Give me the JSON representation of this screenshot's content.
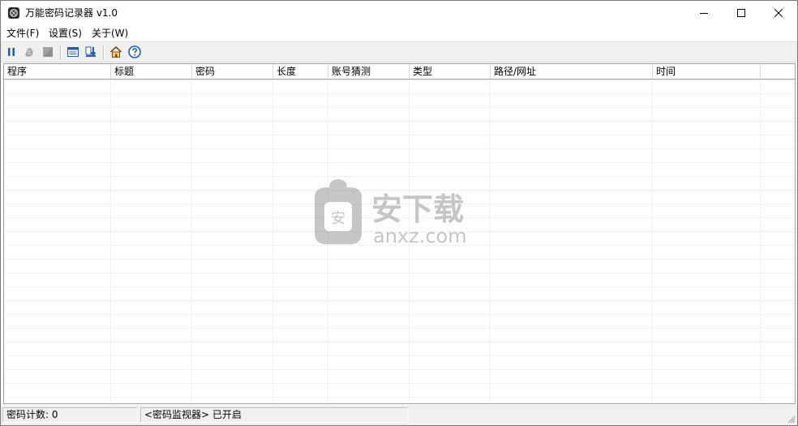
{
  "window": {
    "title": "万能密码记录器 v1.0",
    "app_icon": "app-icon",
    "controls": [
      "minimize-icon",
      "maximize-icon",
      "close-icon"
    ]
  },
  "menu": [
    {
      "label": "文件(F)"
    },
    {
      "label": "设置(S)"
    },
    {
      "label": "关于(W)"
    }
  ],
  "toolbar": [
    {
      "icon": "pause-icon"
    },
    {
      "icon": "clear-icon"
    },
    {
      "icon": "stop-icon"
    },
    {
      "icon": "list-view-icon"
    },
    {
      "icon": "export-icon"
    },
    {
      "icon": "home-icon"
    },
    {
      "icon": "help-icon"
    }
  ],
  "table": {
    "columns": [
      "程序",
      "标题",
      "密码",
      "长度",
      "账号猜测",
      "类型",
      "路径/网址",
      "时间"
    ],
    "rows": []
  },
  "watermark": {
    "text_cn": "安下载",
    "text_en": "anxz.com"
  },
  "status": {
    "count_label": "密码计数:  0",
    "monitor_label": "<密码监视器> 已开启"
  },
  "colors": {
    "accent_blue": "#1a5fb4",
    "watermark_gray": "#9a9a9a"
  }
}
